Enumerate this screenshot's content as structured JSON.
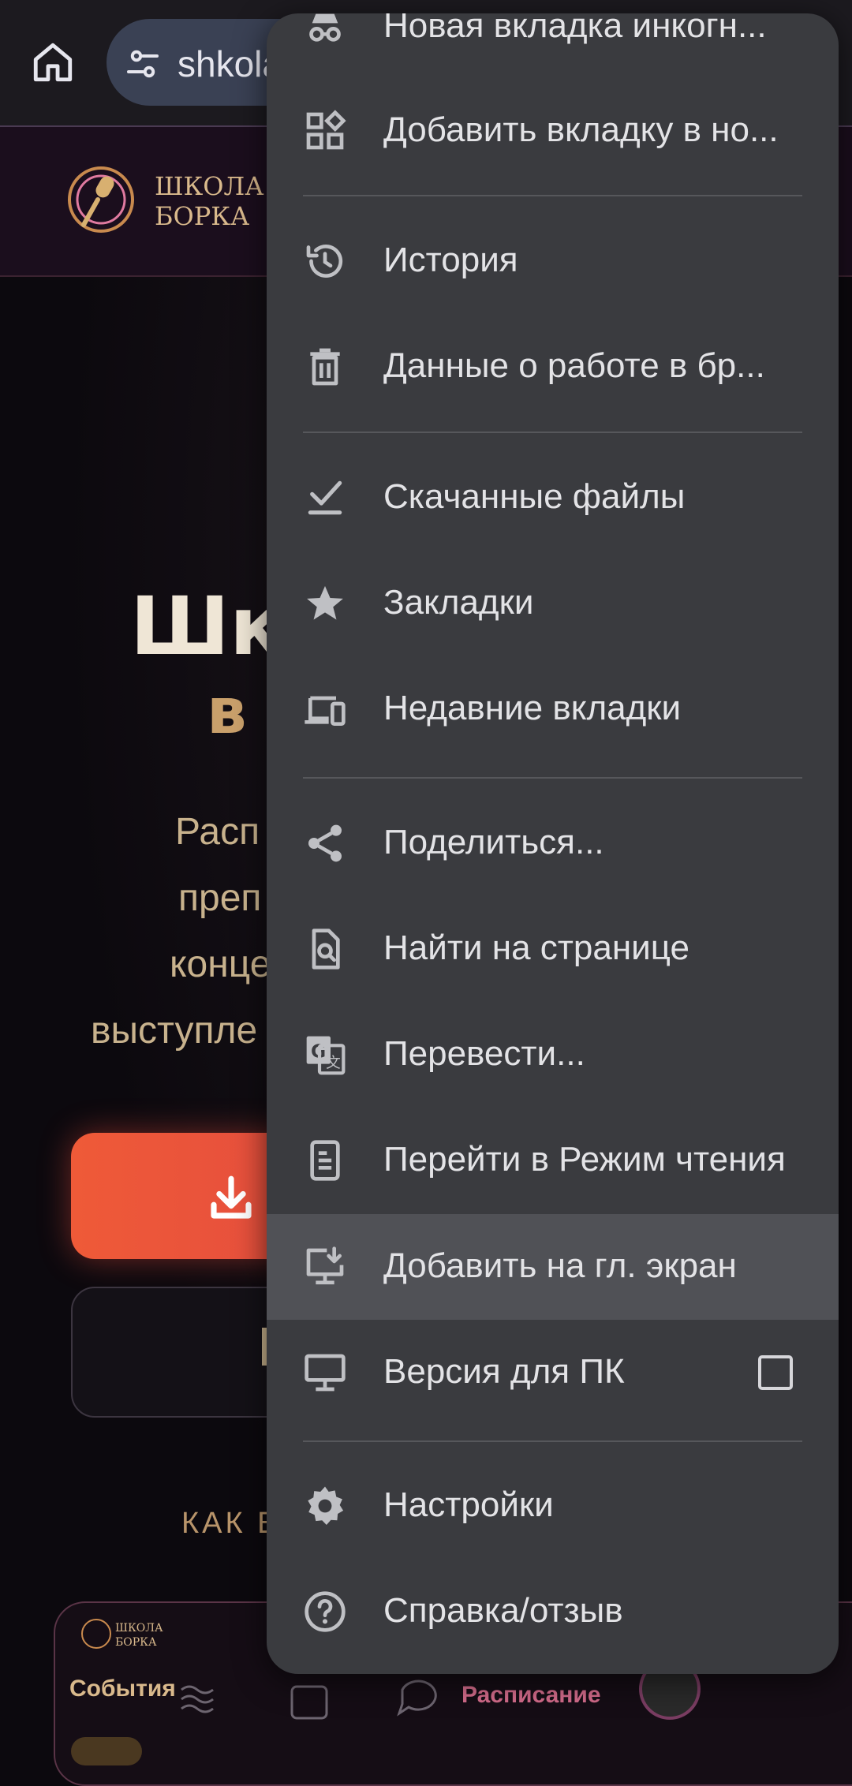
{
  "browser": {
    "url": "shkola"
  },
  "hero": {
    "title_line1": "Шк",
    "title_line2": "в",
    "subtitle_lines": [
      "Расп",
      "преп",
      "конце",
      "выступле"
    ],
    "how_label": "КАК В"
  },
  "mini_preview": {
    "events_label": "События",
    "schedule_label": "Расписание"
  },
  "menu": {
    "items": [
      {
        "label": "Новая вкладка инкогн...",
        "icon": "incognito-icon"
      },
      {
        "label": "Добавить вкладку в но...",
        "icon": "tab-group-icon"
      },
      {
        "label": "История",
        "icon": "history-icon"
      },
      {
        "label": "Данные  о работе в бр...",
        "icon": "trash-icon"
      },
      {
        "label": "Скачанные файлы",
        "icon": "download-check-icon"
      },
      {
        "label": "Закладки",
        "icon": "star-icon"
      },
      {
        "label": "Недавние вкладки",
        "icon": "devices-icon"
      },
      {
        "label": "Поделиться...",
        "icon": "share-icon"
      },
      {
        "label": "Найти на странице",
        "icon": "find-in-page-icon"
      },
      {
        "label": "Перевести...",
        "icon": "translate-icon"
      },
      {
        "label": "Перейти в Режим чтения",
        "icon": "reader-mode-icon"
      },
      {
        "label": "Добавить на гл. экран",
        "icon": "add-to-home-icon"
      },
      {
        "label": "Версия для ПК",
        "icon": "desktop-icon"
      },
      {
        "label": "Настройки",
        "icon": "settings-icon"
      },
      {
        "label": "Справка/отзыв",
        "icon": "help-icon"
      }
    ],
    "desktop_version_checked": false
  },
  "colors": {
    "menu_bg": "#3a3b3f",
    "menu_highlight": "#505156",
    "menu_text": "#e3e3e6",
    "accent_button": "#e74c3c",
    "gold_text": "#c9a06b"
  }
}
